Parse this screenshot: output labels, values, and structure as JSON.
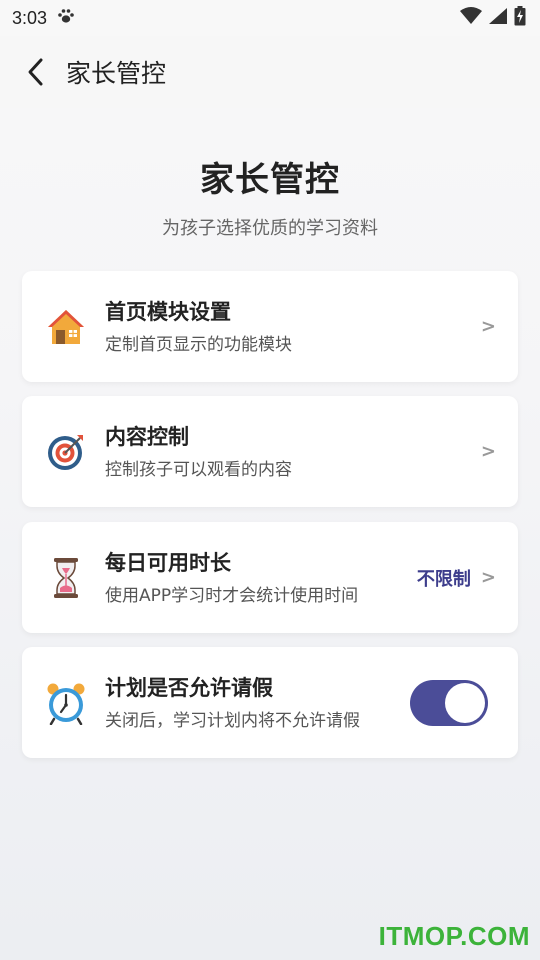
{
  "status_bar": {
    "time": "3:03",
    "icons": [
      "paw-icon",
      "wifi-icon",
      "signal-icon",
      "battery-charging-icon"
    ]
  },
  "app_bar": {
    "back_icon": "chevron-left-icon",
    "title": "家长管控"
  },
  "hero": {
    "title": "家长管控",
    "subtitle": "为孩子选择优质的学习资料"
  },
  "settings": [
    {
      "icon": "house-icon",
      "title": "首页模块设置",
      "subtitle": "定制首页显示的功能模块",
      "chevron": ">"
    },
    {
      "icon": "target-icon",
      "title": "内容控制",
      "subtitle": "控制孩子可以观看的内容",
      "chevron": ">"
    },
    {
      "icon": "hourglass-icon",
      "title": "每日可用时长",
      "subtitle": "使用APP学习时才会统计使用时间",
      "value": "不限制",
      "chevron": ">"
    },
    {
      "icon": "alarm-clock-icon",
      "title": "计划是否允许请假",
      "subtitle": "关闭后，学习计划内将不允许请假",
      "toggle_on": true
    }
  ],
  "watermark": "ITMOP.COM",
  "colors": {
    "accent": "#4b4d98",
    "value_text": "#3d3d8c",
    "watermark": "#3cb33a"
  }
}
